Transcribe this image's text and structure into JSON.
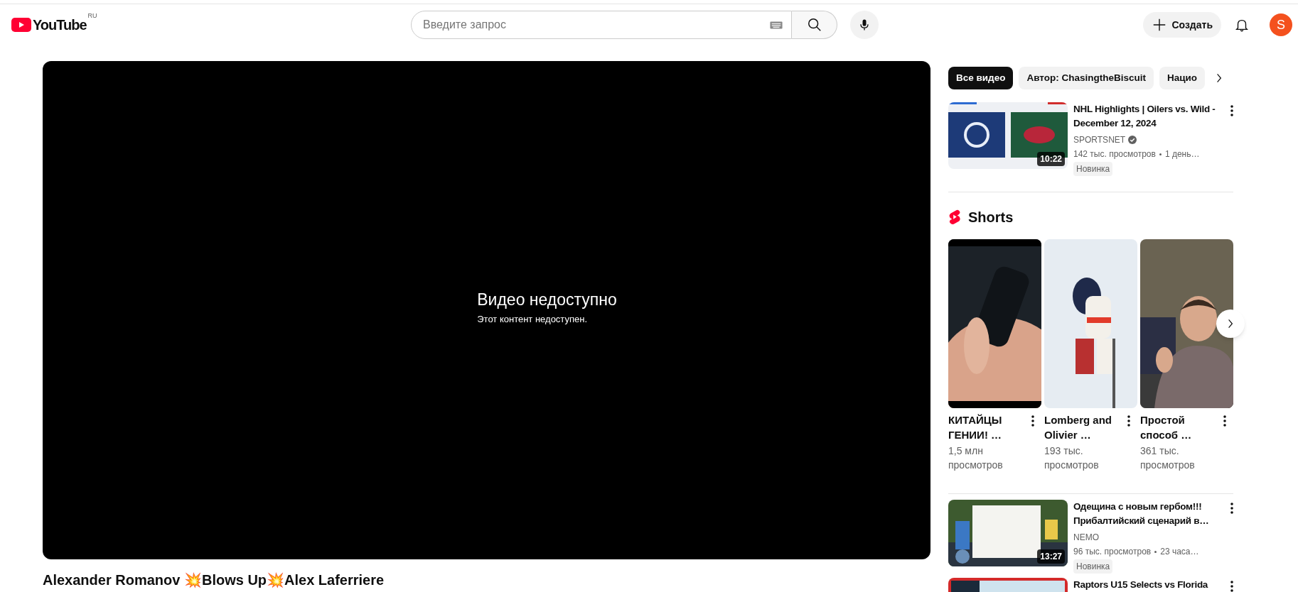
{
  "header": {
    "logo_text": "YouTube",
    "country": "RU",
    "search": {
      "placeholder": "Введите запрос"
    },
    "create_label": "Создать",
    "avatar_letter": "S"
  },
  "player": {
    "message": "Видео недоступно",
    "detail": "Этот контент недоступен."
  },
  "video_title": "Alexander Romanov 💥Blows Up💥Alex Laferriere",
  "chips": [
    {
      "label": "Все видео",
      "selected": true
    },
    {
      "label": "Автор: ChasingtheBiscuit",
      "selected": false
    },
    {
      "label": "Нацио",
      "selected": false
    }
  ],
  "feed": [
    {
      "kind": "video",
      "title": "NHL Highlights | Oilers vs. Wild - December 12, 2024",
      "channel": "SPORTSNET",
      "verified": true,
      "views": "142 тыс. просмотров",
      "age": "1 день…",
      "badge": "Новинка",
      "duration": "10:22"
    },
    {
      "kind": "shorts",
      "title": "Shorts",
      "items": [
        {
          "title": "КИТАЙЦЫ ГЕНИИ! …",
          "views": "1,5 млн просмотров"
        },
        {
          "title": "Lomberg and Olivier …",
          "views": "193 тыс. просмотров"
        },
        {
          "title": "Простой способ …",
          "views": "361 тыс. просмотров"
        }
      ]
    },
    {
      "kind": "video",
      "title": "Одещина с новым гербом!!! Прибалтийский сценарий в…",
      "channel": "NEMO",
      "verified": false,
      "views": "96 тыс. просмотров",
      "age": "23 часа…",
      "badge": "Новинка",
      "duration": "13:27"
    },
    {
      "kind": "video",
      "title": "Raptors U15 Selects vs Florida"
    }
  ]
}
